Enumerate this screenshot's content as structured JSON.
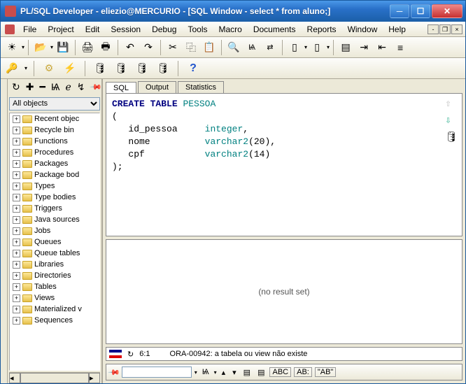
{
  "title": "PL/SQL Developer - eliezio@MERCURIO - [SQL Window - select * from aluno;]",
  "menu": [
    "File",
    "Project",
    "Edit",
    "Session",
    "Debug",
    "Tools",
    "Macro",
    "Documents",
    "Reports",
    "Window",
    "Help"
  ],
  "sidebar": {
    "filter": "All objects",
    "items": [
      "Recent objec",
      "Recycle bin",
      "Functions",
      "Procedures",
      "Packages",
      "Package bod",
      "Types",
      "Type bodies",
      "Triggers",
      "Java sources",
      "Jobs",
      "Queues",
      "Queue tables",
      "Libraries",
      "Directories",
      "Tables",
      "Views",
      "Materialized v",
      "Sequences"
    ]
  },
  "tabs": [
    "SQL",
    "Output",
    "Statistics"
  ],
  "code": {
    "l1a": "CREATE",
    "l1b": "TABLE",
    "l1c": "PESSOA",
    "l2": "(",
    "l3a": "id_pessoa",
    "l3b": "integer",
    "l3c": ",",
    "l4a": "nome",
    "l4b": "varchar2",
    "l4c": "(",
    "l4d": "20",
    "l4e": "),",
    "l5a": "cpf",
    "l5b": "varchar2",
    "l5c": "(",
    "l5d": "14",
    "l5e": ")",
    "l6": ");"
  },
  "result": "(no result set)",
  "status": {
    "pos": "6:1",
    "msg": "ORA-00942: a tabela ou view não existe"
  },
  "bottom": {
    "abc1": "ABC",
    "abc2": "AB:",
    "ab": "\"AB\""
  }
}
